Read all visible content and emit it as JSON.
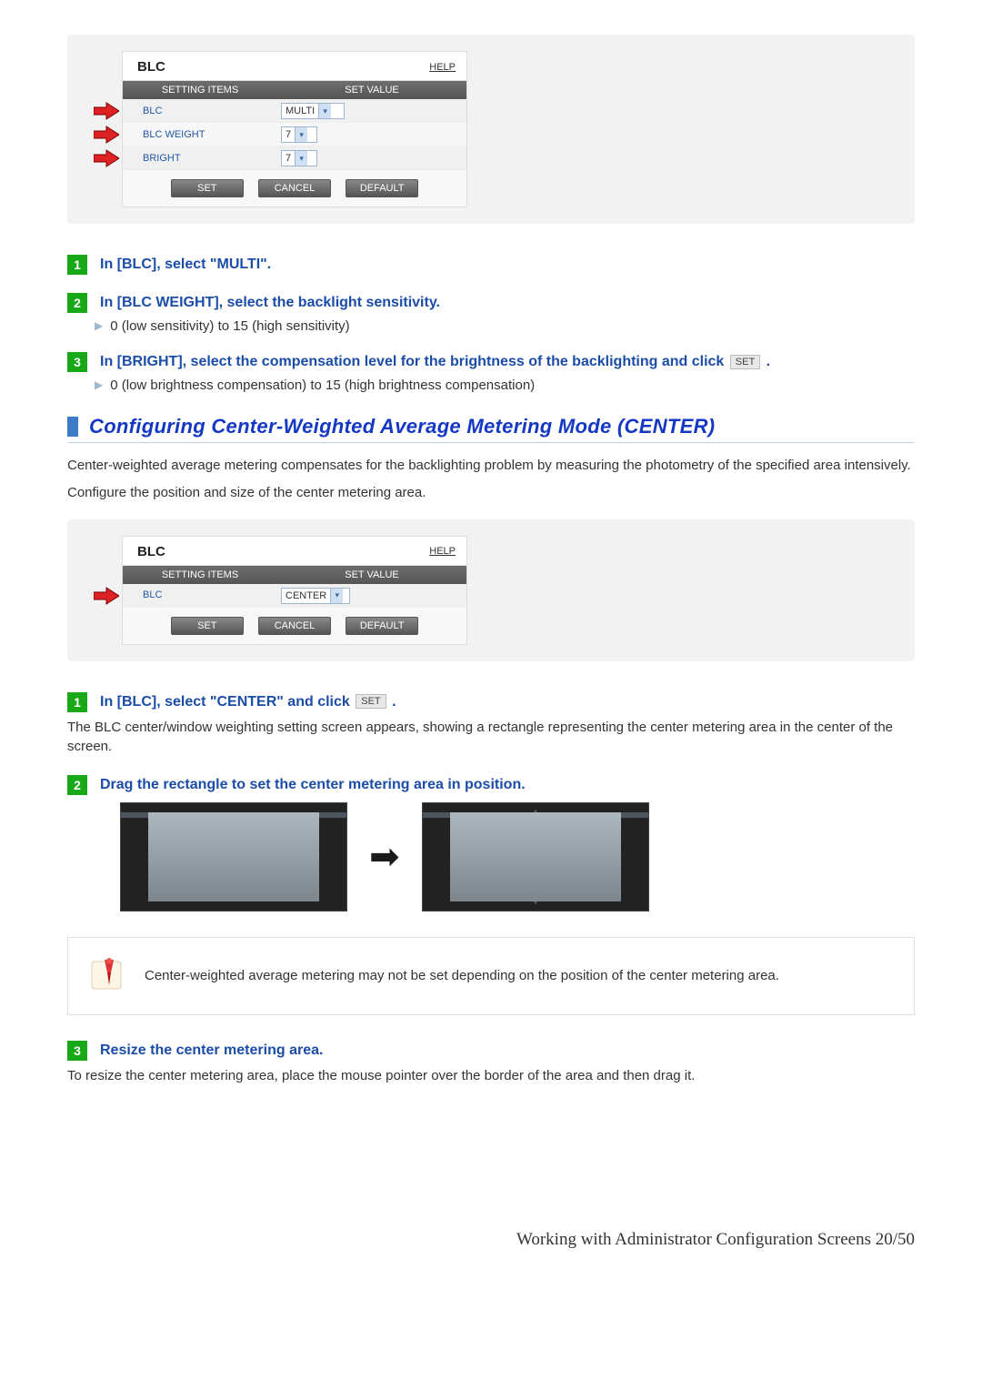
{
  "panel1": {
    "title": "BLC",
    "help": "HELP",
    "hdr_items": "SETTING ITEMS",
    "hdr_value": "SET VALUE",
    "rows": [
      {
        "label": "BLC",
        "value": "MULTI"
      },
      {
        "label": "BLC WEIGHT",
        "value": "7"
      },
      {
        "label": "BRIGHT",
        "value": "7"
      }
    ],
    "btn_set": "SET",
    "btn_cancel": "CANCEL",
    "btn_default": "DEFAULT"
  },
  "steps_a": {
    "s1": "In [BLC], select \"MULTI\".",
    "s2": "In [BLC WEIGHT], select the backlight sensitivity.",
    "s2_note": "0 (low sensitivity) to 15 (high sensitivity)",
    "s3_a": "In [BRIGHT], select the compensation level for the brightness of the backlighting and click ",
    "s3_set": "SET",
    "s3_b": " .",
    "s3_note": "0 (low brightness compensation) to 15 (high brightness compensation)"
  },
  "section_title": "Configuring Center-Weighted Average Metering Mode (CENTER)",
  "section_p1": "Center-weighted average metering compensates for the backlighting problem by measuring the photometry of the specified area intensively.",
  "section_p2": "Configure the position and size of the center metering area.",
  "panel2": {
    "title": "BLC",
    "help": "HELP",
    "hdr_items": "SETTING ITEMS",
    "hdr_value": "SET VALUE",
    "row_label": "BLC",
    "row_value": "CENTER",
    "btn_set": "SET",
    "btn_cancel": "CANCEL",
    "btn_default": "DEFAULT"
  },
  "steps_b": {
    "s1_a": "In [BLC], select \"CENTER\" and click ",
    "s1_set": "SET",
    "s1_b": " .",
    "s1_after": "The BLC center/window weighting setting screen appears, showing a rectangle representing the center metering area in the center of the screen.",
    "s2": "Drag the rectangle to set the center metering area in position.",
    "note": "Center-weighted average metering may not be set depending on the position of the center metering area.",
    "s3": "Resize the center metering area.",
    "s3_after": "To resize the center metering area, place the mouse pointer over the border of the area and then drag it."
  },
  "nums": {
    "n1": "1",
    "n2": "2",
    "n3": "3"
  },
  "footer": "Working with Administrator Configuration Screens 20/50"
}
